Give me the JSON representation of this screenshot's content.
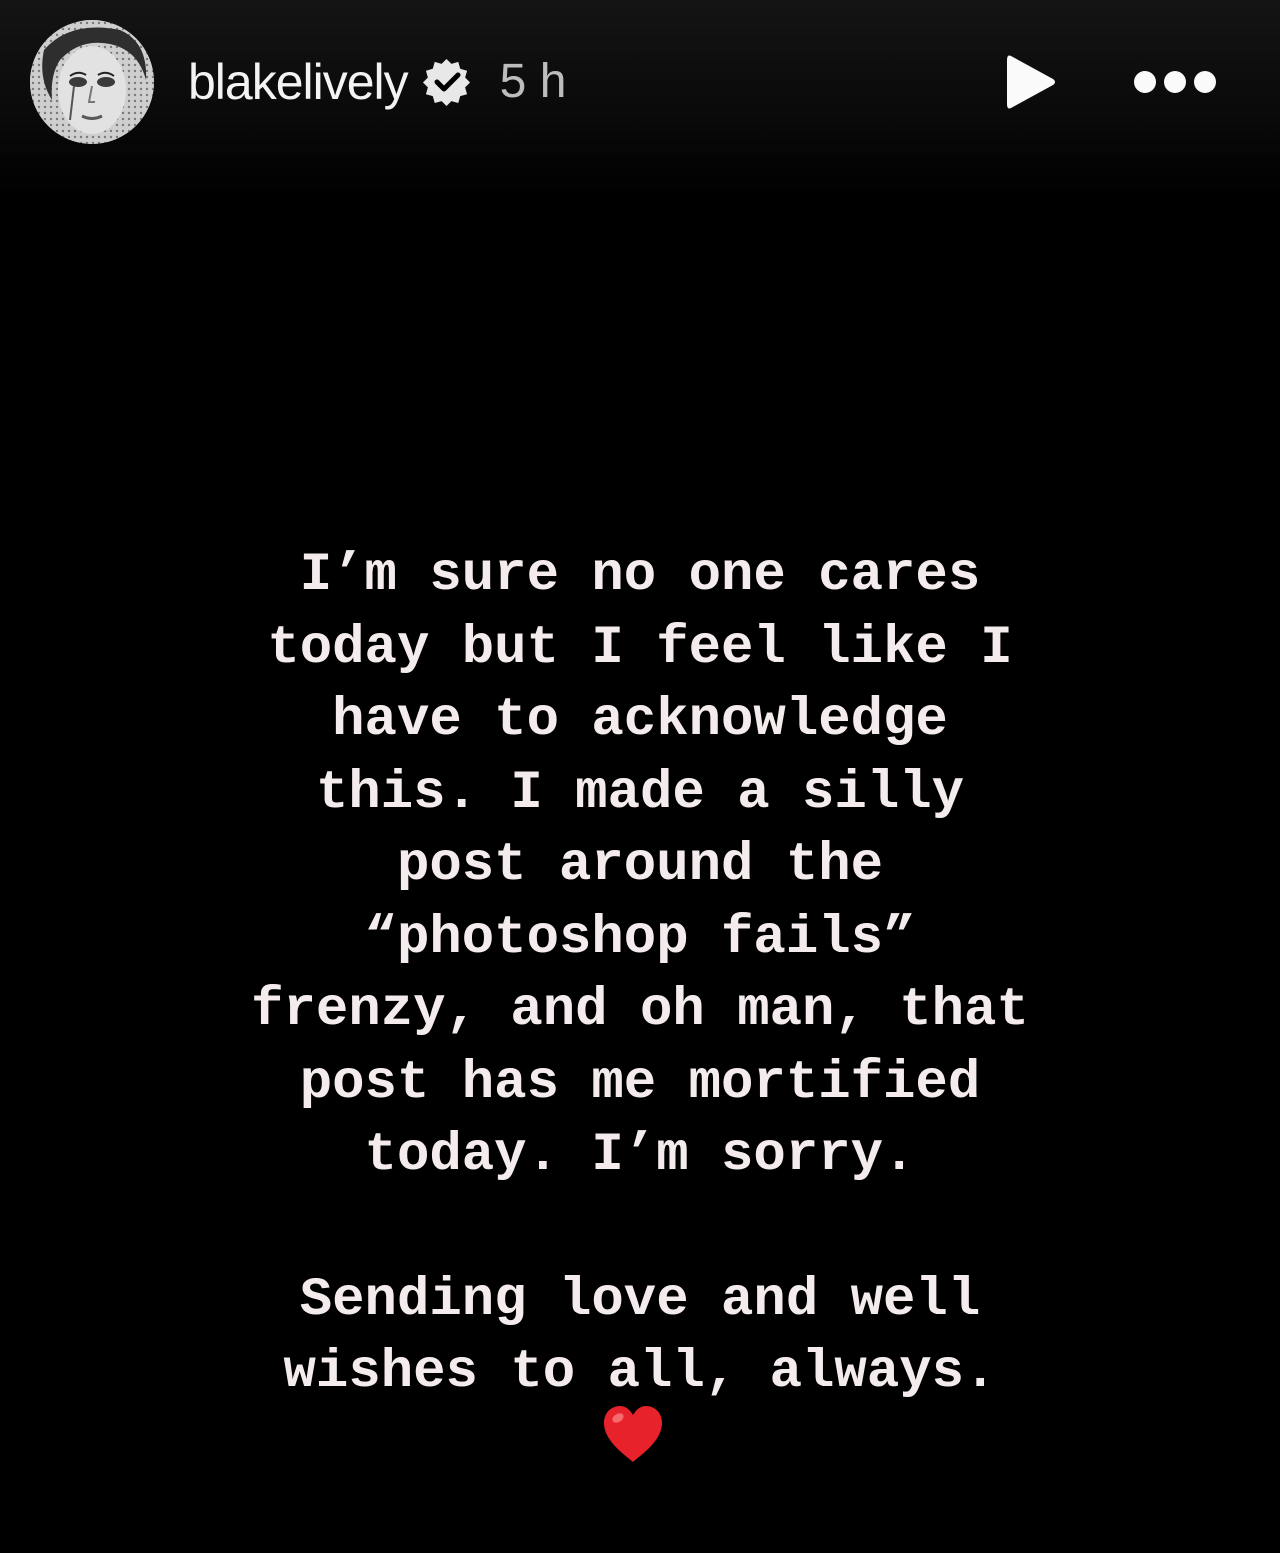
{
  "header": {
    "username": "blakelively",
    "time": "5 h",
    "verified_icon": "verified-badge-icon",
    "play_icon": "play-icon",
    "more_icon": "more-dots-icon"
  },
  "story_text": {
    "paragraph1": [
      "I’m sure no one cares",
      "today but I feel like I",
      "have to acknowledge",
      "this. I made a silly",
      "post around the",
      "“photoshop fails”",
      "frenzy, and oh man, that",
      "post has me mortified",
      "today. I’m sorry."
    ],
    "paragraph2": [
      "Sending love and well",
      "wishes to all, always."
    ],
    "emoji": "red-heart-icon"
  },
  "colors": {
    "background": "#000000",
    "text": "#f4ecec",
    "heart": "#e8222b"
  }
}
